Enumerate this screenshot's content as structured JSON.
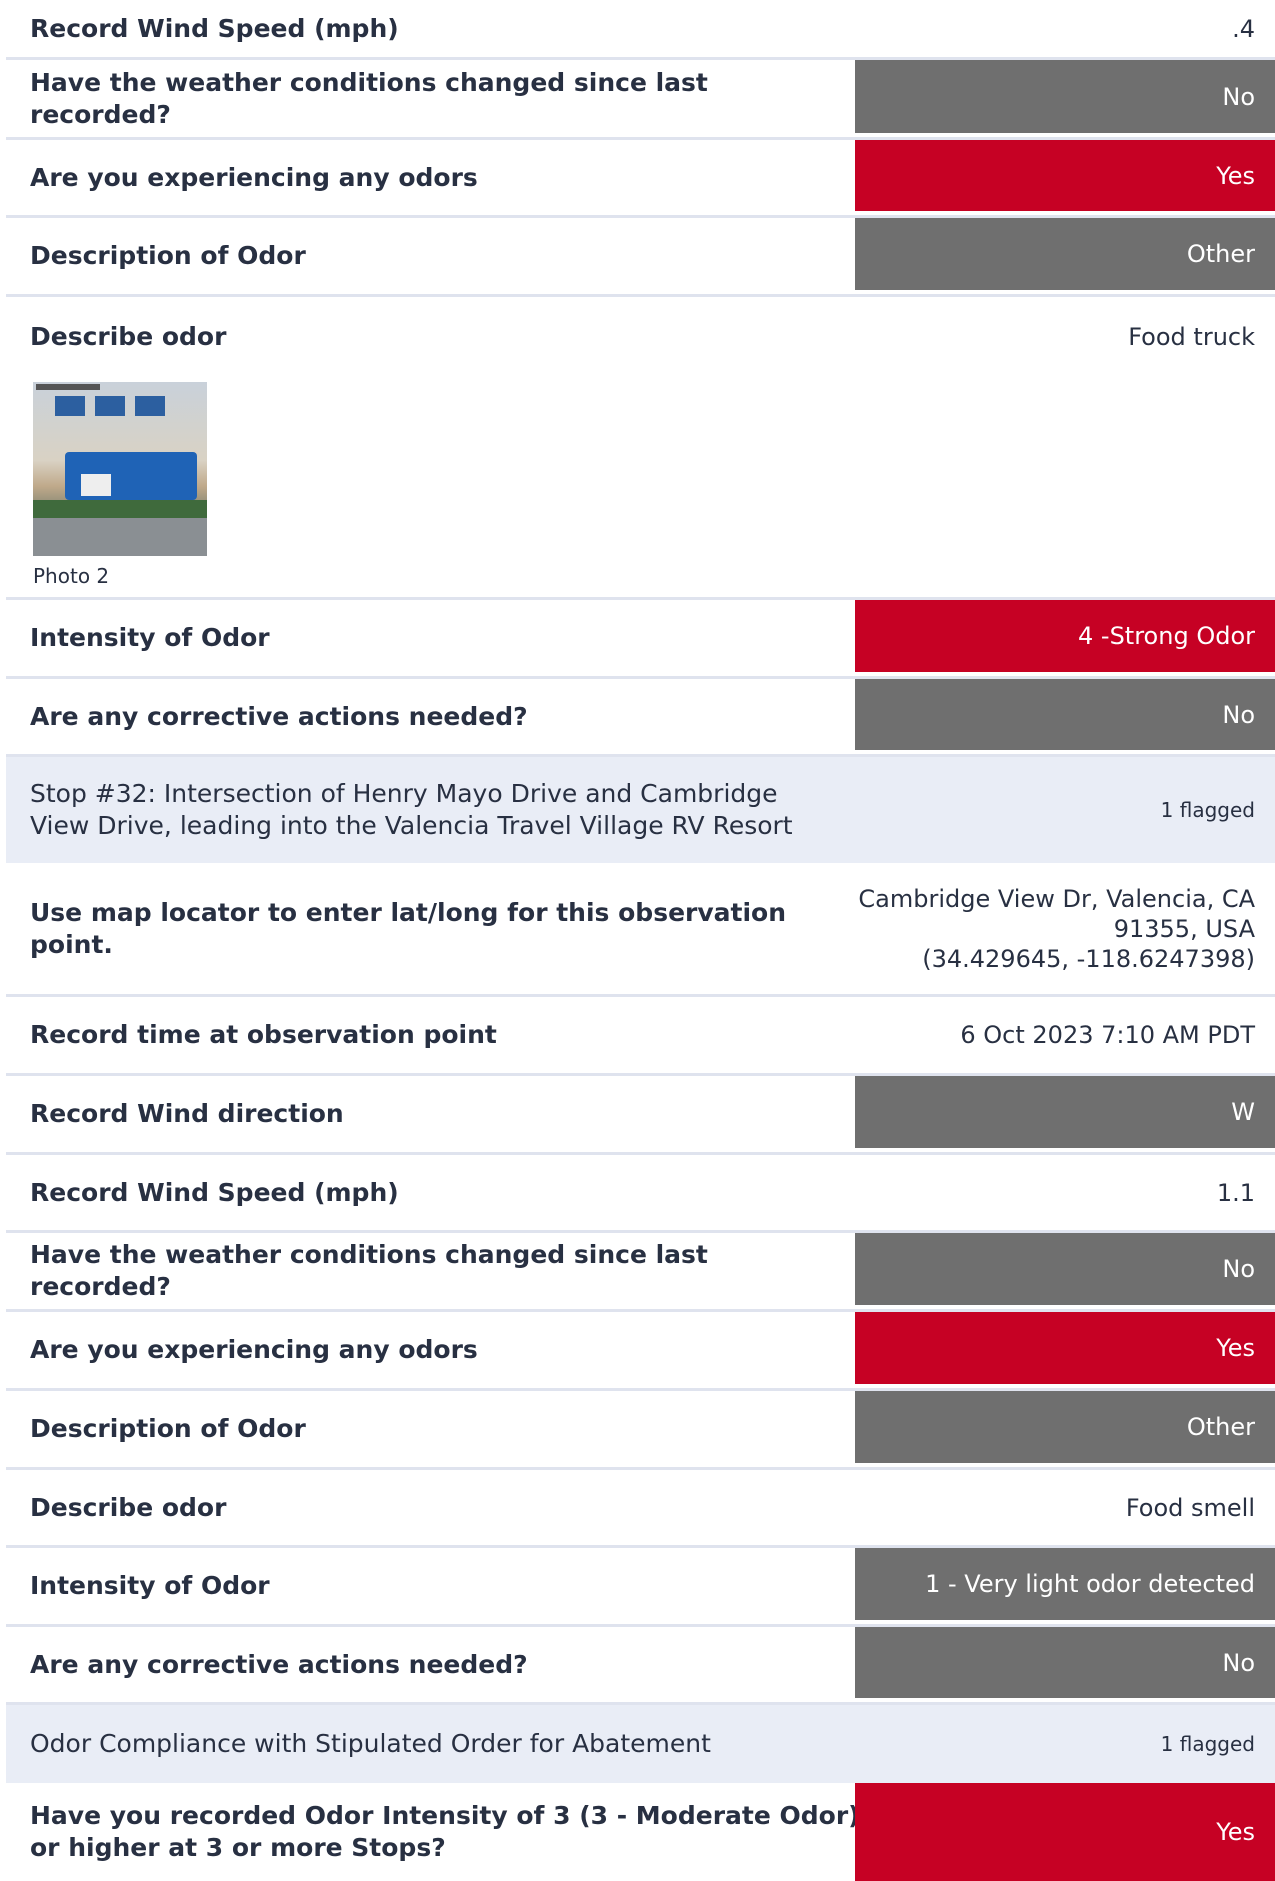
{
  "block1": {
    "wind_speed": {
      "label": "Record Wind Speed (mph)",
      "value": ".4"
    },
    "weather_changed": {
      "label": "Have the weather conditions changed since last recorded?",
      "value": "No"
    },
    "odors": {
      "label": "Are you experiencing any odors",
      "value": "Yes"
    },
    "odor_description": {
      "label": "Description of Odor",
      "value": "Other"
    },
    "describe_odor": {
      "label": "Describe odor",
      "value": "Food truck"
    },
    "photo_caption": "Photo 2",
    "odor_intensity": {
      "label": "Intensity of Odor",
      "value": "4 -Strong Odor"
    },
    "corrective": {
      "label": "Are any corrective actions needed?",
      "value": "No"
    }
  },
  "section_stop32": {
    "title": "Stop #32: Intersection of Henry Mayo Drive and Cambridge View Drive, leading into the Valencia Travel Village RV Resort",
    "flag": "1 flagged"
  },
  "block2": {
    "map_locator": {
      "label": "Use map locator to enter lat/long for this observation point.",
      "value_line1": "Cambridge View Dr, Valencia, CA",
      "value_line2": "91355, USA",
      "value_line3": "(34.429645, -118.6247398)"
    },
    "time": {
      "label": "Record time at observation point",
      "value": "6 Oct 2023 7:10 AM PDT"
    },
    "wind_direction": {
      "label": "Record Wind direction",
      "value": "W"
    },
    "wind_speed": {
      "label": "Record Wind Speed (mph)",
      "value": "1.1"
    },
    "weather_changed": {
      "label": "Have the weather conditions changed since last recorded?",
      "value": "No"
    },
    "odors": {
      "label": "Are you experiencing any odors",
      "value": "Yes"
    },
    "odor_description": {
      "label": "Description of Odor",
      "value": "Other"
    },
    "describe_odor": {
      "label": "Describe odor",
      "value": "Food smell"
    },
    "odor_intensity": {
      "label": "Intensity of Odor",
      "value": "1 - Very light odor detected"
    },
    "corrective": {
      "label": "Are any corrective actions needed?",
      "value": "No"
    }
  },
  "section_compliance": {
    "title": "Odor Compliance with Stipulated Order for Abatement",
    "flag": "1 flagged"
  },
  "block3": {
    "intensity_stops": {
      "label": "Have you recorded Odor Intensity of 3 (3 - Moderate Odor) or higher at 3 or more Stops?",
      "value": "Yes"
    }
  },
  "colors": {
    "grey": "#6f6f6f",
    "red": "#c60124",
    "section_bg": "#e9edf6"
  }
}
